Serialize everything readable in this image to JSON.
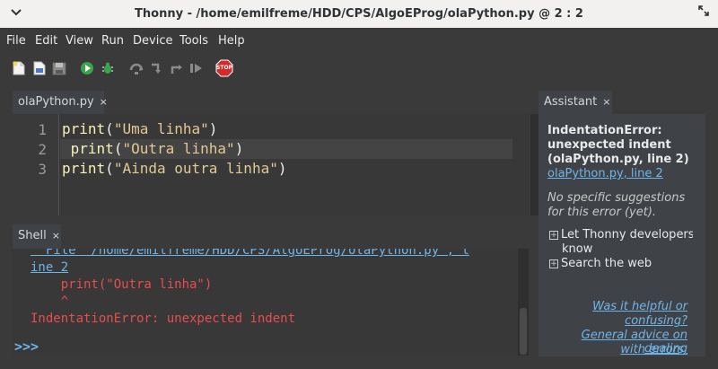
{
  "window": {
    "title": "Thonny  -  /home/emilfreme/HDD/CPS/AlgoEProg/olaPython.py  @  2 : 2"
  },
  "menu": [
    "File",
    "Edit",
    "View",
    "Run",
    "Device",
    "Tools",
    "Help"
  ],
  "toolbar": {
    "icons": [
      "new-file-icon",
      "open-file-icon",
      "save-file-icon",
      "run-icon",
      "debug-icon",
      "step-over-icon",
      "step-into-icon",
      "step-out-icon",
      "resume-icon",
      "stop-icon"
    ],
    "stop_label": "STOP"
  },
  "editor": {
    "tab_label": "olaPython.py",
    "close_glyph": "×",
    "line_numbers": [
      "1",
      "2",
      "3"
    ],
    "lines": [
      {
        "indent": "",
        "fn": "print",
        "open": "(",
        "str": "\"Uma linha\"",
        "close": ")"
      },
      {
        "indent": " ",
        "fn": "print",
        "open": "(",
        "str": "\"Outra linha\"",
        "close": ")"
      },
      {
        "indent": "",
        "fn": "print",
        "open": "(",
        "str": "\"Ainda outra linha\"",
        "close": ")"
      }
    ]
  },
  "shell": {
    "tab_label": "Shell",
    "close_glyph": "×",
    "lines": [
      "  File \"/home/emilfreme/HDD/CPS/AlgoEProg/olaPython.py\", l",
      "ine 2",
      "    print(\"Outra linha\")",
      "    ^",
      "IndentationError: unexpected indent"
    ],
    "prompt": ">>>"
  },
  "assistant": {
    "tab_label": "Assistant",
    "close_glyph": "×",
    "error_title": [
      "IndentationError:",
      "unexpected indent",
      "(olaPython.py, line 2)"
    ],
    "error_link": "olaPython.py, line 2",
    "no_suggestions": [
      "No specific suggestions",
      "for this error (yet)."
    ],
    "expand_glyph": "+",
    "let_thonny": [
      "Let Thonny developers",
      "know"
    ],
    "search_web": "Search the web",
    "was_helpful": [
      "Was it helpful or",
      "confusing?"
    ],
    "general_advice": [
      "General advice on dealing",
      "with errors."
    ]
  },
  "colors": {
    "background": "#3a3a3a",
    "editor_bg": "#383838",
    "error_red": "#e84d4d",
    "link_blue": "#6fb4e8",
    "keyword_yellow": "#f6f3b4",
    "string_tan": "#e2c893"
  }
}
